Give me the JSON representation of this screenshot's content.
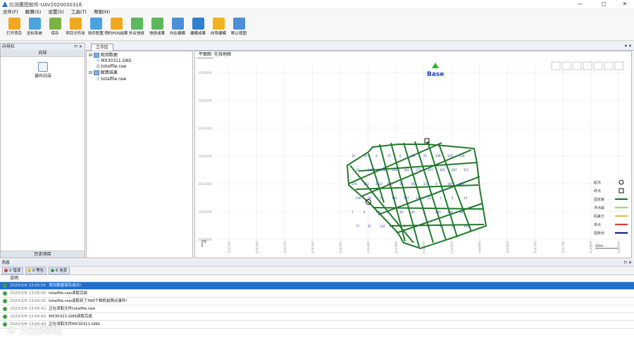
{
  "window": {
    "title": "比测惠图软件-UAV2020030316",
    "min": "—",
    "max": "◻",
    "close": "✕"
  },
  "menu": [
    "文件(F)",
    "解算(S)",
    "设置(S)",
    "工具(T)",
    "帮助(H)"
  ],
  "toolbar": [
    {
      "label": "打开项目",
      "icon": "folder-icon",
      "color": "#f2a81d"
    },
    {
      "label": "坐标系统",
      "icon": "globe-icon",
      "color": "#4aa3df"
    },
    {
      "label": "保存",
      "icon": "save-icon",
      "color": "#7cb342"
    },
    {
      "label": "项目文件夹",
      "icon": "folder-icon",
      "color": "#f2a81d"
    },
    {
      "label": "软件配置",
      "icon": "config-icon",
      "color": "#4aa3df"
    },
    {
      "label": "预约POS结果",
      "icon": "folder-icon",
      "color": "#f2a81d"
    },
    {
      "label": "外业快拼",
      "icon": "photo-icon",
      "color": "#5cb85c"
    },
    {
      "label": "快拼成果",
      "icon": "photo-result-icon",
      "color": "#5cb85c"
    },
    {
      "label": "内业建模",
      "icon": "model-icon",
      "color": "#4a8fd8"
    },
    {
      "label": "建模成果",
      "icon": "model-result-icon",
      "color": "#2f7fd0"
    },
    {
      "label": "向导建模",
      "icon": "wizard-icon",
      "color": "#f2b21d"
    },
    {
      "label": "默认视图",
      "icon": "view-icon",
      "color": "#4a8fd8"
    }
  ],
  "left_panel": {
    "title": "向导栏",
    "pin": "⊓ ✕",
    "header": "向导",
    "wizard_label": "操作向导",
    "footer": "历史项目"
  },
  "workarea": {
    "tab": "工作区",
    "controls": "▾ ✕"
  },
  "tree": {
    "root1": "观测数据",
    "child1": "MX30311.GNS",
    "child2": "totalfile.raw",
    "root2": "解算结果",
    "child3": "totalfile.raw"
  },
  "map": {
    "tabs": [
      "平面图",
      "在线地图"
    ],
    "base_label": "Base",
    "y_ticks": [
      "2542600",
      "2542500",
      "2542400",
      "2542300",
      "2542200",
      "2542100",
      "2542000"
    ],
    "x_ticks": [
      "434150",
      "434200",
      "434250",
      "434300",
      "434350",
      "434400",
      "434450",
      "434500",
      "434550",
      "434600",
      "434650",
      "434700",
      "434750",
      "434800",
      "434850",
      "434900"
    ],
    "scale": "10m",
    "north": "N",
    "legend": [
      {
        "label": "起点",
        "kind": "circle",
        "color": "#111111"
      },
      {
        "label": "终点",
        "kind": "square",
        "color": "#111111"
      },
      {
        "label": "固定解",
        "kind": "line",
        "color": "#1f7a2a"
      },
      {
        "label": "浮点解",
        "kind": "line",
        "color": "#a8d36b"
      },
      {
        "label": "码差分",
        "kind": "line",
        "color": "#f0b84a"
      },
      {
        "label": "单点",
        "kind": "line",
        "color": "#e53935"
      },
      {
        "label": "招转点",
        "kind": "line",
        "color": "#1a237e"
      }
    ],
    "track_labels": [
      "13",
      "14",
      "2",
      "17",
      "6",
      "19",
      "21",
      "236",
      "135",
      "134",
      "15",
      "1416",
      "1416",
      "143",
      "162",
      "173",
      "247",
      "281",
      "297",
      "317",
      "176",
      "252",
      "2517",
      "617",
      "31",
      "91",
      "13",
      "3",
      "167",
      "181",
      "236",
      "34",
      "1",
      "181",
      "167",
      "142",
      "22",
      "1",
      "2",
      "24",
      "7",
      "4",
      "163",
      "2",
      "16",
      "45",
      "2",
      "243",
      "341",
      "18",
      "77",
      "21",
      "142",
      "4",
      "6",
      "7",
      "8",
      "9",
      "10",
      "300"
    ]
  },
  "messages": {
    "title": "消息",
    "controls": "⊓ ✕",
    "filters": [
      {
        "label": "0 错误",
        "color": "#e53935"
      },
      {
        "label": "0 警告",
        "color": "#f2b21d"
      },
      {
        "label": "6 信息",
        "color": "#3aa33a"
      }
    ],
    "column": "说明",
    "rows": [
      {
        "time": "2020/3/6 13:09:00",
        "text": "项目数据保存成功!",
        "selected": true
      },
      {
        "time": "2020/3/6 13:09:00",
        "text": "totalfile.raw读取完成",
        "selected": false
      },
      {
        "time": "2020/3/6 13:09:00",
        "text": "totalfile.raw读取到了360个相机拍照点事件!",
        "selected": false
      },
      {
        "time": "2020/3/6 13:09:42",
        "text": "正在读取文件totalfile.raw",
        "selected": false
      },
      {
        "time": "2020/3/6 13:09:42",
        "text": "MX30311.GNS读取完成",
        "selected": false
      },
      {
        "time": "2020/3/6 13:09:40",
        "text": "正在读取文件MX30311.GNS",
        "selected": false
      }
    ]
  },
  "watermark": "大数跨境"
}
